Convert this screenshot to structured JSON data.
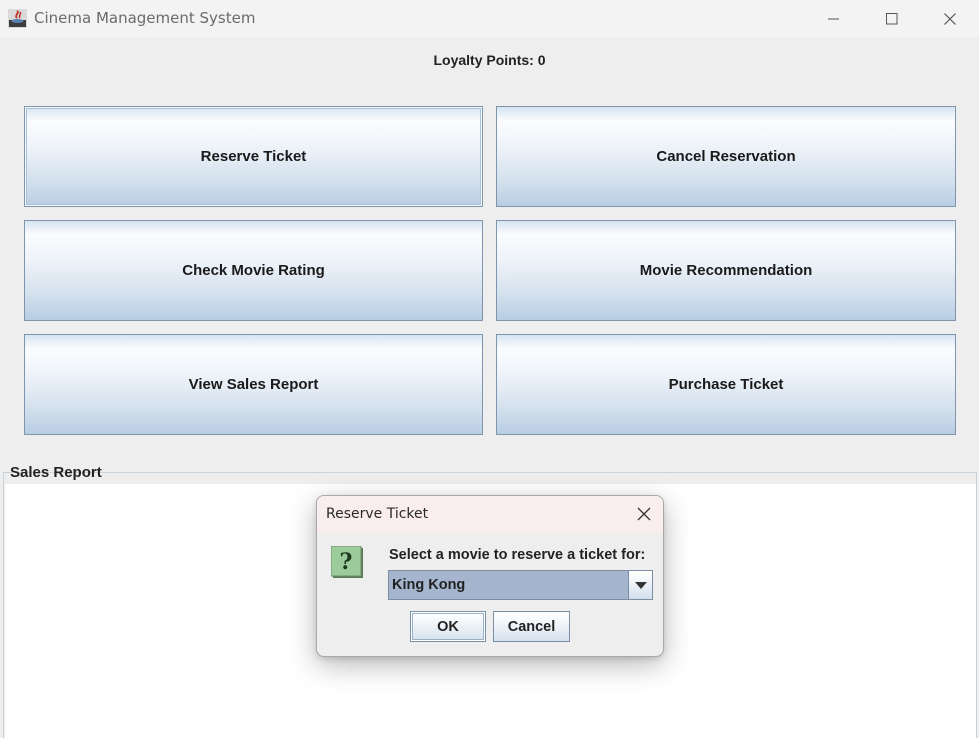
{
  "window": {
    "title": "Cinema Management System",
    "controls": [
      "minimize",
      "maximize",
      "close"
    ]
  },
  "loyalty": {
    "text": "Loyalty Points: 0"
  },
  "menu": {
    "buttons": [
      {
        "label": "Reserve Ticket"
      },
      {
        "label": "Cancel Reservation"
      },
      {
        "label": "Check Movie Rating"
      },
      {
        "label": "Movie Recommendation"
      },
      {
        "label": "View Sales Report"
      },
      {
        "label": "Purchase Ticket"
      }
    ]
  },
  "sales_report": {
    "label": "Sales Report",
    "content": ""
  },
  "dialog": {
    "title": "Reserve Ticket",
    "message": "Select a movie to reserve a ticket for:",
    "selected_movie": "King Kong",
    "ok_label": "OK",
    "cancel_label": "Cancel",
    "icon": "question-icon"
  },
  "colors": {
    "button_gradient_top": "#fbfcfe",
    "button_gradient_bottom": "#b8cde3",
    "combo_selected": "#a4b5cd",
    "dialog_titlebar": "#f9eded"
  }
}
